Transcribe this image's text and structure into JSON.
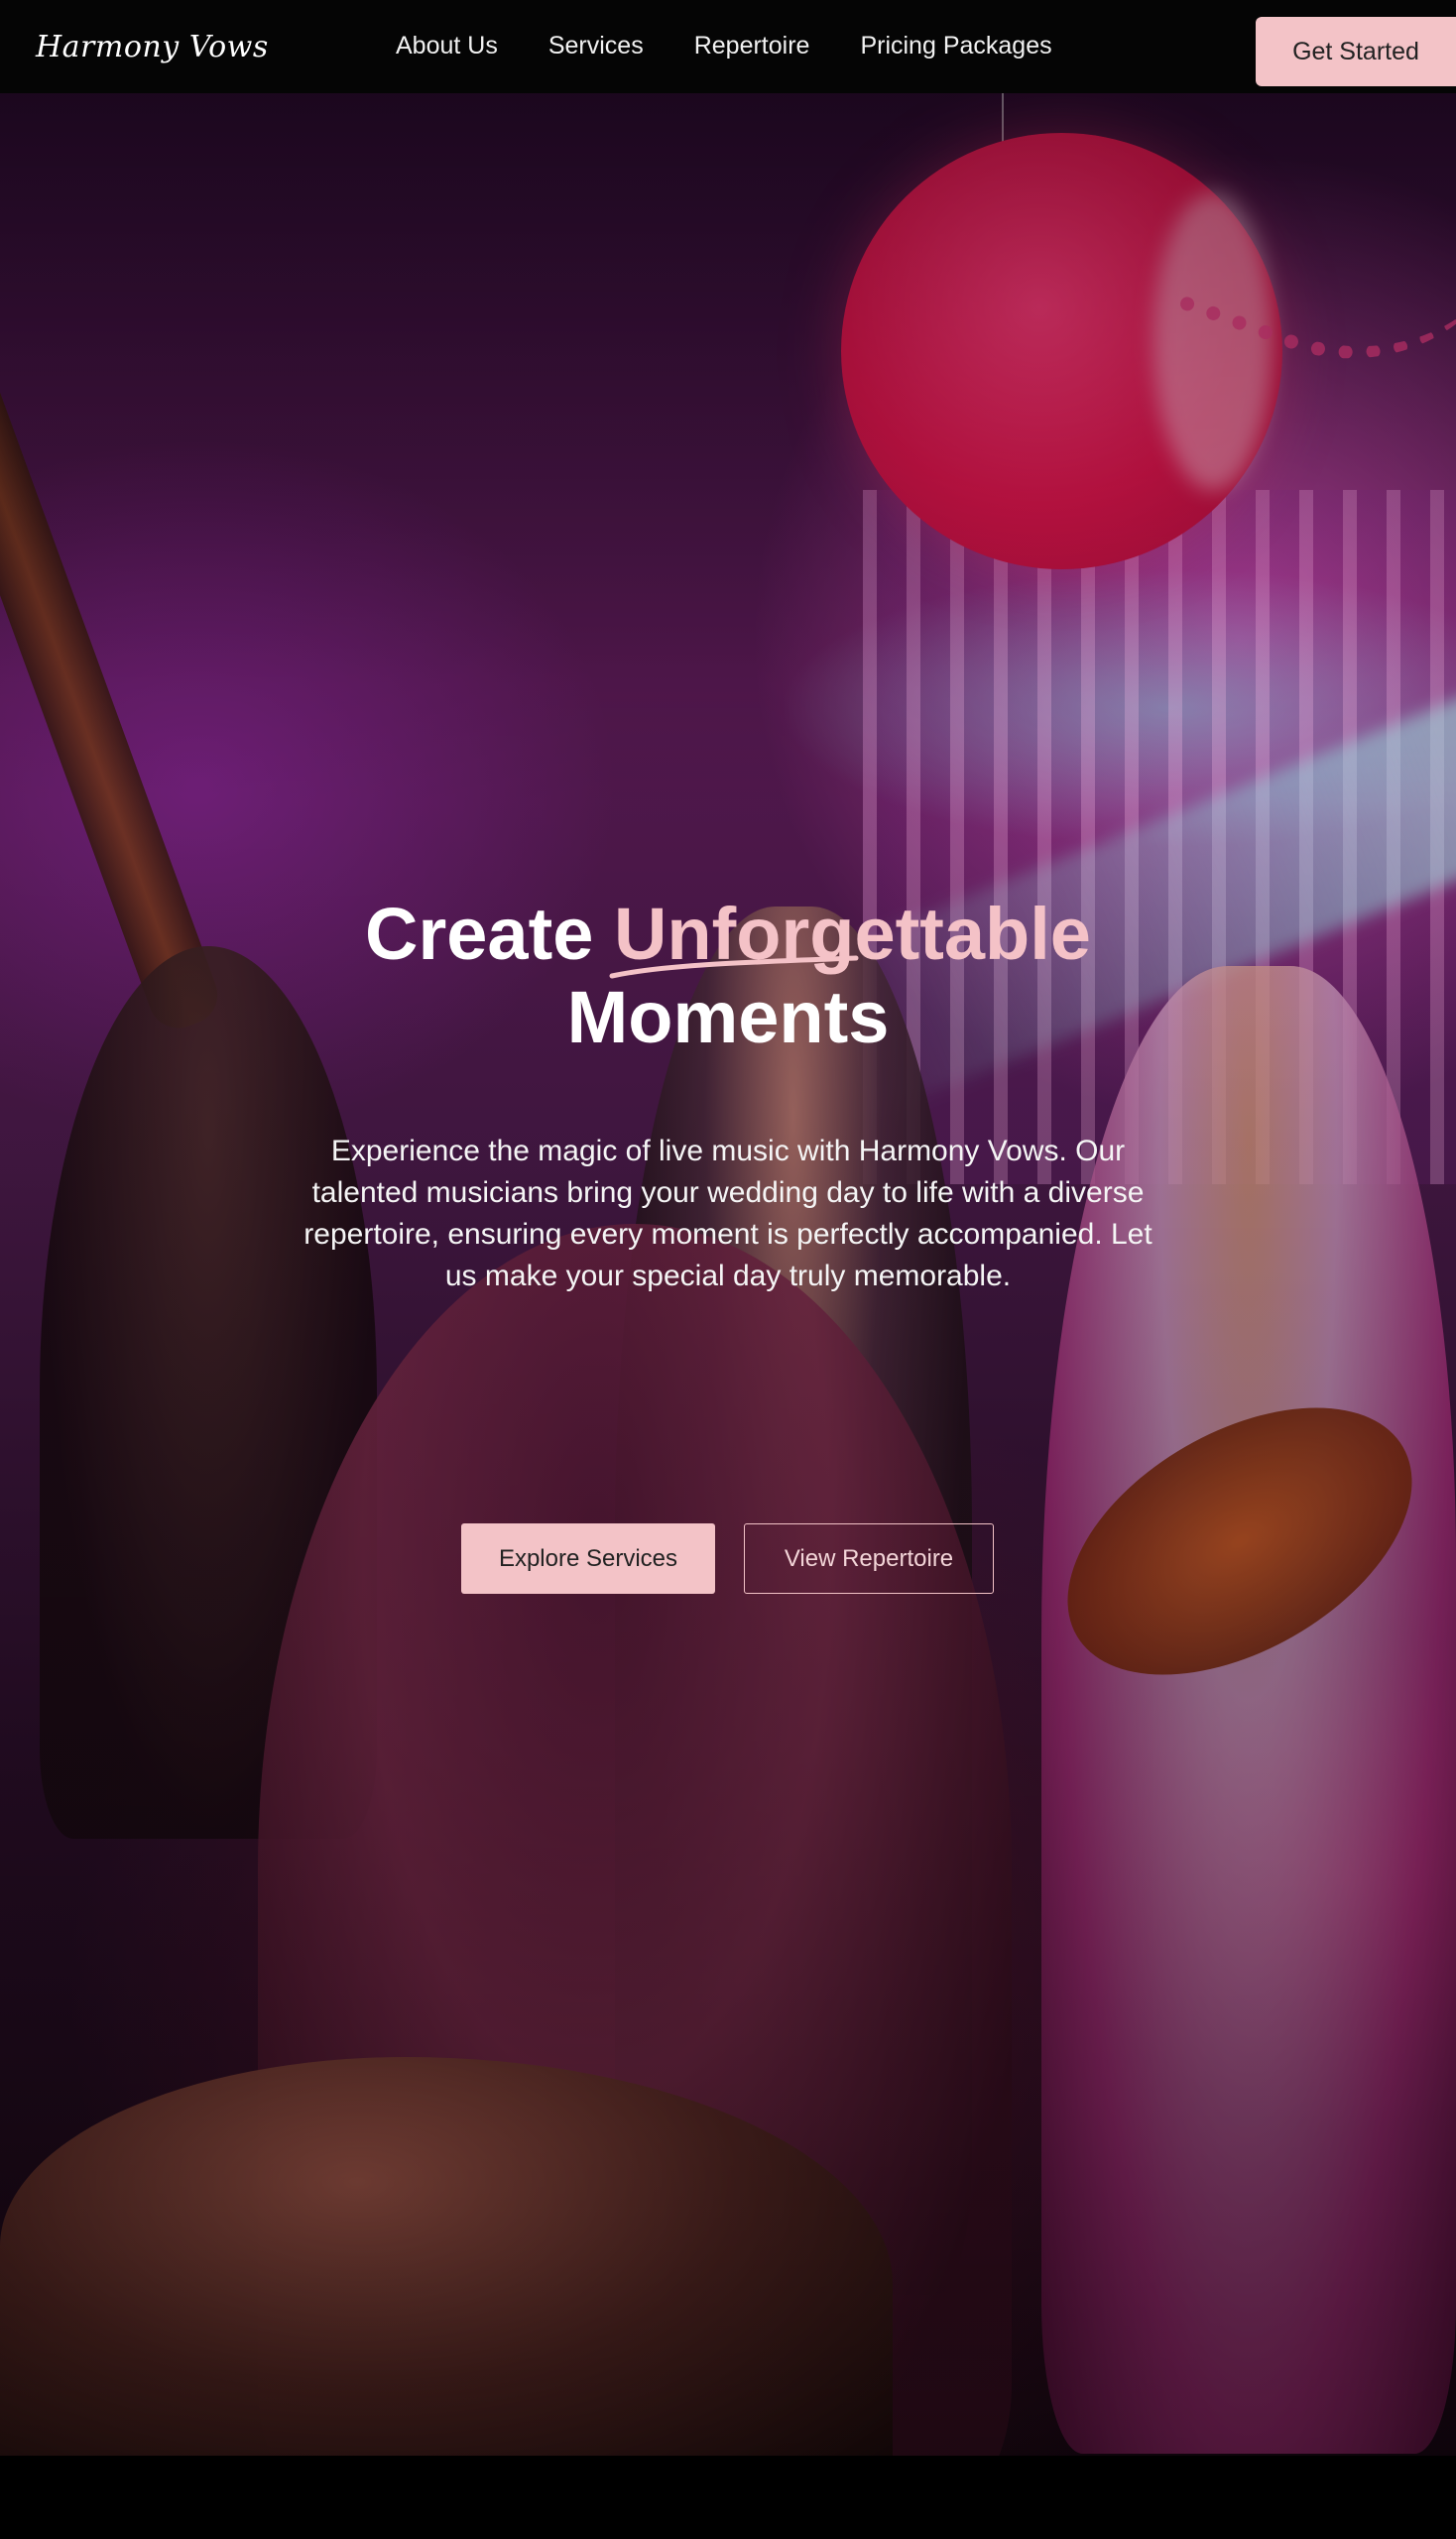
{
  "nav": {
    "logo": "Harmony Vows",
    "links": [
      "About Us",
      "Services",
      "Repertoire",
      "Pricing Packages"
    ],
    "cta_label": "Get Started"
  },
  "hero": {
    "title_lead": "Create",
    "title_accent": "Unforgettable",
    "title_end": "Moments",
    "subtitle": "Experience the magic of live music with Harmony Vows. Our talented musicians bring your wedding day to life with a diverse repertoire, ensuring every moment is perfectly accompanied. Let us make your special day truly memorable.",
    "primary_button": "Explore Services",
    "secondary_button": "View Repertoire"
  },
  "colors": {
    "accent": "#f3c3c7",
    "nav_background": "#050505",
    "page_background": "#000000"
  }
}
